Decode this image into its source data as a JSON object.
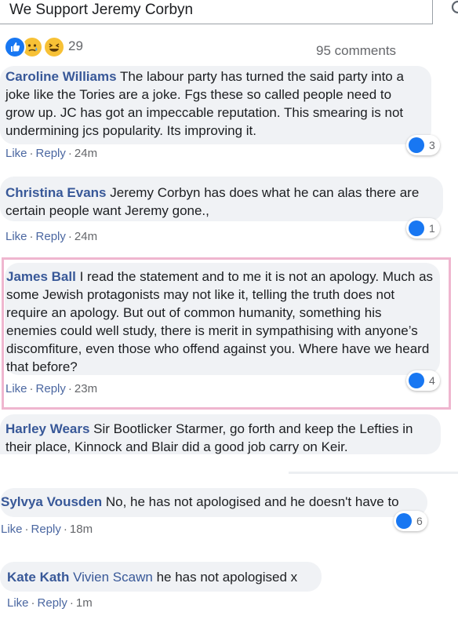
{
  "search": {
    "value": "We Support Jeremy Corbyn"
  },
  "reactions": {
    "count": "29",
    "types": [
      "like-icon",
      "sad-icon",
      "haha-icon"
    ]
  },
  "comments_count": "95 comments",
  "meta_labels": {
    "like": "Like",
    "reply": "Reply",
    "sep": "·"
  },
  "comments": [
    {
      "author": "Caroline Williams",
      "text": "The labour party has turned the said party into a joke like the Tories are a joke. Fgs these so called people need to grow up. JC has got an impeccable reputation. This smearing is not undermining jcs popularity. Its improving it.",
      "time": "24m",
      "likes": "3"
    },
    {
      "author": "Christina Evans",
      "text": "Jeremy Corbyn has does what he can alas there are certain people want Jeremy gone.,",
      "time": "24m",
      "likes": "1"
    },
    {
      "author": "James Ball",
      "text": "I read the statement and to me it is not an apology. Much as some Jewish protagonists may not like it, telling the truth does not require an apology. But out of common humanity, something his enemies could well study, there is merit in sympathising with anyone’s discomfiture, even those who offend against you. Where have we heard that before?",
      "time": "23m",
      "likes": "4"
    },
    {
      "author": "Harley Wears",
      "text": "Sir Bootlicker Starmer, go forth and keep the Lefties in their place, Kinnock and Blair did a good job carry on Keir."
    },
    {
      "author": "Sylvya Vousden",
      "text": "No, he has not apologised and he doesn't have to",
      "time": "18m",
      "likes": "6"
    },
    {
      "author": "Kate Kath",
      "mention": "Vivien Scawn",
      "text": "he has not apologised x",
      "time": "1m"
    }
  ],
  "colors": {
    "author": "#385898",
    "meta": "#65676b",
    "bubble": "#f0f2f5",
    "like_blue": "#1877f2",
    "highlight": "#efb6cf"
  }
}
